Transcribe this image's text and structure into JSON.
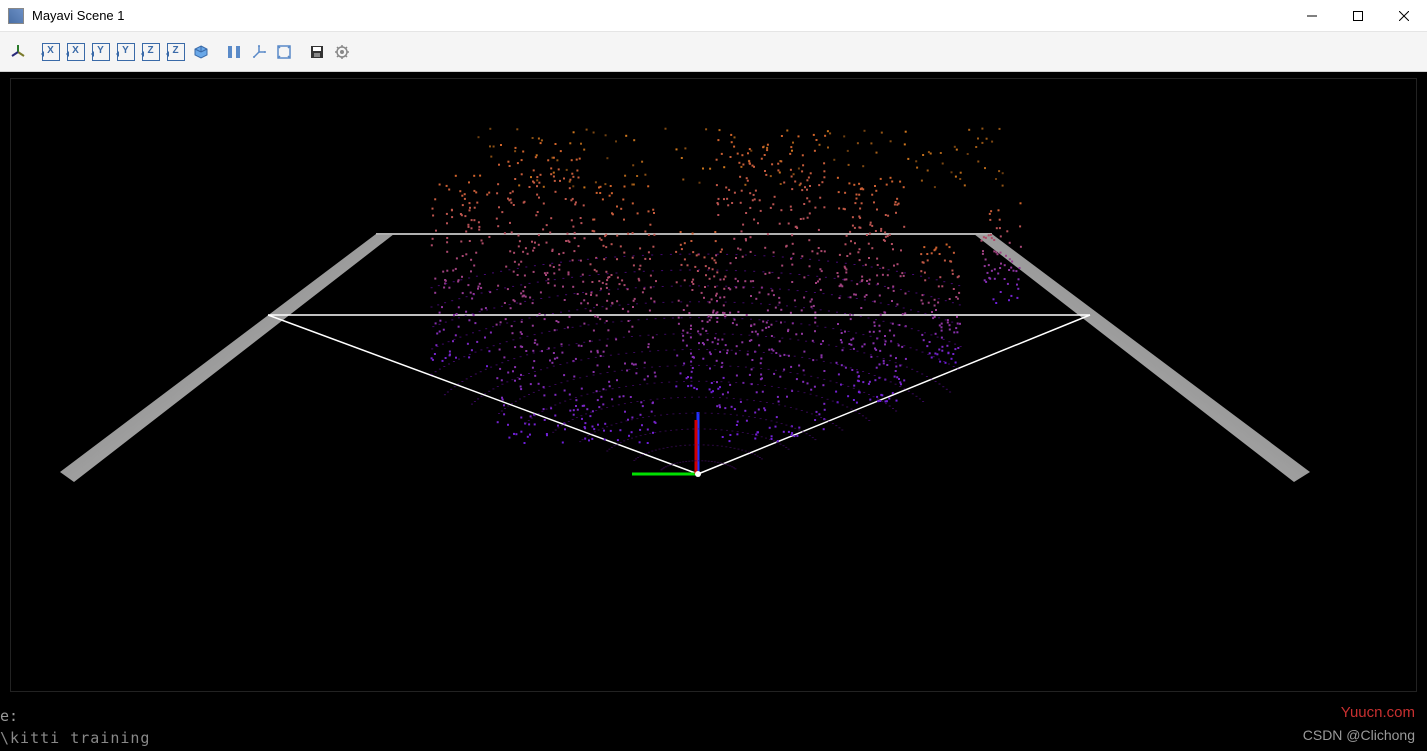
{
  "window": {
    "title": "Mayavi Scene 1"
  },
  "toolbar": {
    "view_axes": [
      "X",
      "X",
      "Y",
      "Y",
      "Z",
      "Z"
    ],
    "icons": {
      "actor": "actor-icon",
      "iso": "iso-view-icon",
      "parallel": "parallel-projection-icon",
      "axes": "axes-indicator-icon",
      "fullscreen": "fullscreen-icon",
      "save": "save-icon",
      "settings": "settings-icon"
    }
  },
  "terminal": {
    "line1": "e:",
    "line2": "\\kitti training"
  },
  "watermarks": {
    "site": "Yuucn.com",
    "author": "CSDN @Clichong"
  },
  "scene": {
    "origin_axes": {
      "x_color": "#00e000",
      "z_color": "#2030ff",
      "y_color": "#d00000"
    },
    "ground_plane_color": "#b8b8b8",
    "fov_line_color": "#ffffff"
  }
}
